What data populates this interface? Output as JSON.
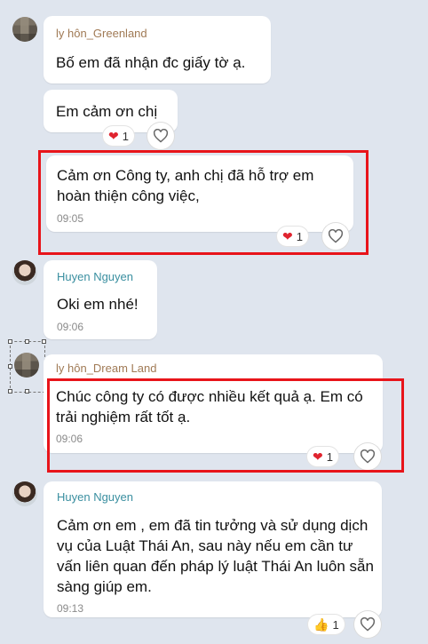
{
  "messages": [
    {
      "sender": "ly hôn_Greenland",
      "text": "Bố em đã nhận đc giấy tờ ạ."
    },
    {
      "text": "Em cảm ơn chị",
      "reaction": {
        "icon": "❤",
        "count": "1"
      }
    },
    {
      "text": "Cảm ơn Công ty, anh chị đã hỗ trợ em hoàn thiện công việc,",
      "time": "09:05",
      "reaction": {
        "icon": "❤",
        "count": "1"
      }
    },
    {
      "sender": "Huyen Nguyen",
      "text": "Oki em nhé!",
      "time": "09:06"
    },
    {
      "sender": "ly hôn_Dream Land",
      "text": "Chúc công ty có được nhiều kết quả ạ. Em có trải nghiệm rất tốt ạ.",
      "time": "09:06",
      "reaction": {
        "icon": "❤",
        "count": "1"
      }
    },
    {
      "sender": "Huyen Nguyen",
      "text": "Cảm ơn em , em đã tin tưởng và sử dụng dịch vụ của Luật Thái An, sau này nếu em cần tư vấn liên quan đến pháp lý  luật Thái An luôn sẵn sàng giúp em.",
      "time": "09:13",
      "reaction": {
        "icon": "👍",
        "count": "1"
      }
    }
  ],
  "colors": {
    "highlight": "#e8141a",
    "sender": "#3a8fa0",
    "background": "#dfe5ee"
  }
}
